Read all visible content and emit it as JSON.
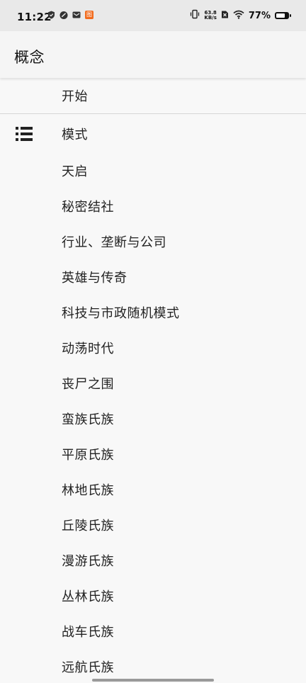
{
  "status_bar": {
    "time": "11:22",
    "net_speed_value": "63.8",
    "net_speed_unit": "KB/s",
    "battery": "77%",
    "battery_level": 0.77,
    "left_icons": [
      "shield-icon",
      "link-icon",
      "mail-icon",
      "app-badge-icon"
    ],
    "app_badge_text": "图",
    "right_icons": [
      "vibrate-icon",
      "no-sim-icon",
      "wifi-icon",
      "battery-icon"
    ]
  },
  "app_bar": {
    "title": "概念"
  },
  "list": {
    "items": [
      {
        "label": "开始"
      },
      {
        "label": "模式",
        "icon": "list-icon"
      },
      {
        "label": "天启"
      },
      {
        "label": "秘密结社"
      },
      {
        "label": "行业、垄断与公司"
      },
      {
        "label": "英雄与传奇"
      },
      {
        "label": "科技与市政随机模式"
      },
      {
        "label": "动荡时代"
      },
      {
        "label": "丧尸之围"
      },
      {
        "label": "蛮族氏族"
      },
      {
        "label": "平原氏族"
      },
      {
        "label": "林地氏族"
      },
      {
        "label": "丘陵氏族"
      },
      {
        "label": "漫游氏族"
      },
      {
        "label": "丛林氏族"
      },
      {
        "label": "战车氏族"
      },
      {
        "label": "远航氏族"
      }
    ]
  }
}
